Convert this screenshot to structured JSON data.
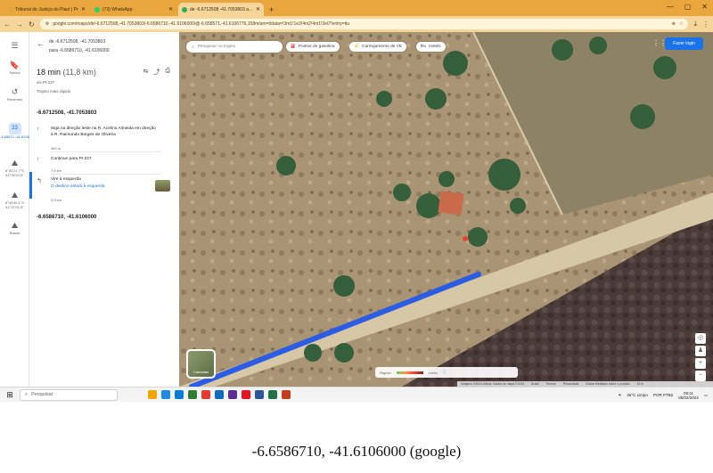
{
  "browser": {
    "tabs": [
      {
        "title": "Tribunal de Justiça do Piauí | Pr...",
        "active": false,
        "color": "#e8a23a"
      },
      {
        "title": "(73) WhatsApp",
        "active": false,
        "color": "#25d366"
      },
      {
        "title": "de -6.6712508 -41.7053803 a...",
        "active": true,
        "color": "#34a853"
      }
    ],
    "new_tab": "+",
    "window_controls": [
      "—",
      "▢",
      "✕"
    ],
    "nav": [
      "←",
      "→",
      "↻"
    ],
    "url": "google.com/maps/dir/-6.6712508,-41.7053803/-6.6586710,-41.6106000/@-6.658571,-41.6106776,158m/am=t/data=!3m1!1e3!4m2!4m1!3e0?entry=ttu",
    "toolbar_icons": [
      "⊕",
      "☆",
      "⤓",
      "⋮"
    ]
  },
  "rail": {
    "items": [
      {
        "icon": "☰",
        "label": ""
      },
      {
        "icon": "🔖",
        "label": "Salvos"
      },
      {
        "icon": "↺",
        "label": "Recentes"
      },
      {
        "icon": "23",
        "label": "-6.65871 -41.6106"
      },
      {
        "icon": "📍",
        "label": "6°40'21.7\"S 41°35'23.4\""
      },
      {
        "icon": "📍",
        "label": "6°40'40.1\"S 41°37'01.9\""
      },
      {
        "icon": "⬇",
        "label": "Baixar"
      }
    ]
  },
  "panel": {
    "back": "←",
    "from_label": "de -6.6712508, -41.7053803",
    "to_label": "para -6.6586710, -41.6106000",
    "time": "18 min",
    "distance": "(11,8 km)",
    "via": "via PI-227",
    "fastest": "Trajeto mais rápido",
    "summary_icons": [
      "⇆",
      "⤴",
      "⎙"
    ],
    "start_coord": "-6.6712508, -41.7053803",
    "steps": [
      {
        "icon": "↑",
        "text": "Siga na direção leste na R. Acelino Almeida em direção à R. Raimundo Borges de Oliveira",
        "dist": "450 m"
      },
      {
        "icon": "↑",
        "text": "Continue para PI-227",
        "dist": "7,8 km"
      },
      {
        "icon": "↰",
        "text": "Vire à esquerda",
        "sub": "O destino estará à esquerda",
        "dist": "3,5 km"
      }
    ],
    "end_coord": "-6.6586710, -41.6106000"
  },
  "map": {
    "search_placeholder": "Pesquisar no trajeto",
    "chips": [
      "Postos de gasolina",
      "Carregamento de VE",
      "Hotéis"
    ],
    "sign_in": "Fazer login",
    "layers_label": "Camadas",
    "legend_left": "Rápido",
    "legend_right": "Lento",
    "attribution": [
      "Imagens ©2024 Airbus, Dados do mapa ©2024",
      "Brasil",
      "Termos",
      "Privacidade",
      "Enviar feedback sobre o produto",
      "10 m"
    ],
    "route_color": "#2b5ce6"
  },
  "taskbar": {
    "search": "Pesquisar",
    "apps": [
      "#f0a500",
      "#1e88e5",
      "#0b7dd8",
      "#2e7d32",
      "#e53935",
      "#0f6cbd",
      "#5c2d91",
      "#e81123",
      "#2b579a",
      "#217346",
      "#c43e1c"
    ],
    "weather": "25°C Limpo",
    "lang": "POR PTB2",
    "time": "09:11",
    "date": "05/02/2024"
  },
  "caption": "-6.6586710, -41.6106000 (google)"
}
